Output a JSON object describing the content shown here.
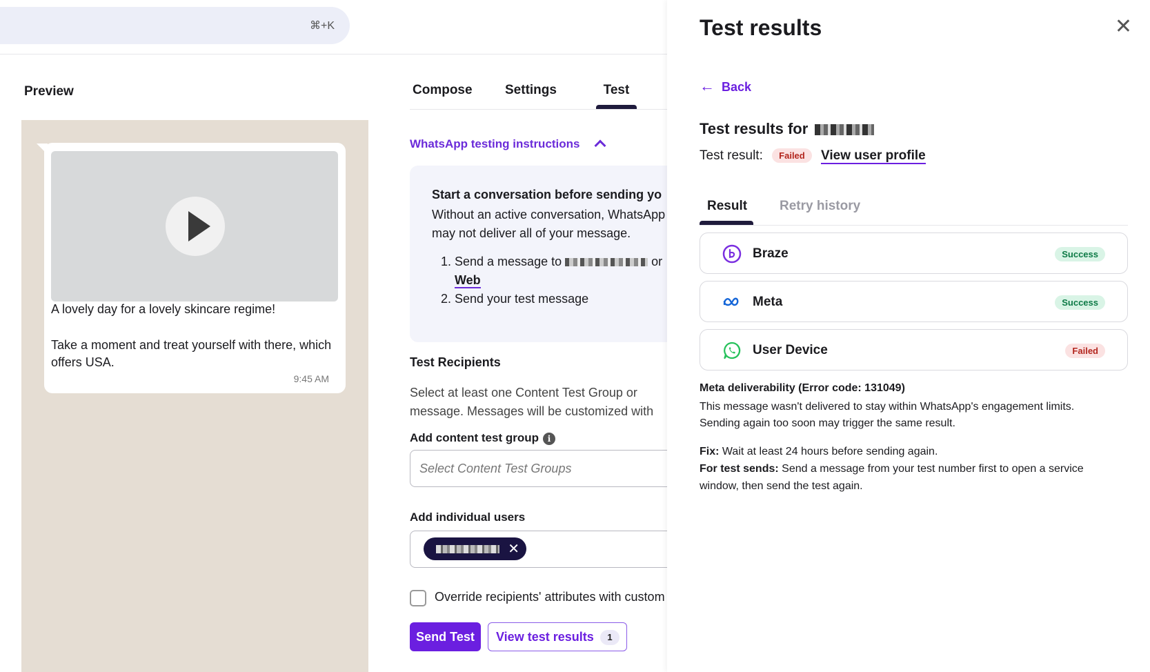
{
  "search": {
    "shortcut": "⌘+K"
  },
  "preview": {
    "title": "Preview",
    "message_line1": "A lovely day for a lovely skincare regime!",
    "message_line2": "Take a moment and treat yourself with there, which offers USA.",
    "time": "9:45 AM"
  },
  "tabs": [
    {
      "label": "Compose"
    },
    {
      "label": "Settings"
    },
    {
      "label": "Test",
      "active": true
    }
  ],
  "instructions": {
    "toggle_label": "WhatsApp testing instructions",
    "title": "Start a conversation before sending yo",
    "body": "Without an active conversation, WhatsApp may not deliver all of your message.",
    "step1_prefix": "Send a message to",
    "step1_suffix": "or",
    "step1_link": "Web",
    "step2": "Send your test message"
  },
  "recipients": {
    "title": "Test Recipients",
    "body_line1": "Select at least one Content Test Group or",
    "body_line2": "message. Messages will be customized with",
    "content_group_label": "Add content test group",
    "content_group_placeholder": "Select Content Test Groups",
    "individual_label": "Add individual users",
    "override_label": "Override recipients' attributes with custom"
  },
  "actions": {
    "send_test": "Send Test",
    "view_results": "View test results",
    "results_count": "1"
  },
  "panel": {
    "title": "Test results",
    "back": "Back",
    "results_for": "Test results for",
    "result_label": "Test result:",
    "result_status": "Failed",
    "view_profile": "View user profile",
    "tabs": [
      {
        "label": "Result",
        "active": true
      },
      {
        "label": "Retry history"
      }
    ],
    "steps": [
      {
        "name": "Braze",
        "status": "Success",
        "icon": "braze-icon"
      },
      {
        "name": "Meta",
        "status": "Success",
        "icon": "meta-icon"
      },
      {
        "name": "User Device",
        "status": "Failed",
        "icon": "whatsapp-icon"
      }
    ],
    "error_title": "Meta deliverability (Error code: 131049)",
    "error_body": "This message wasn't delivered to stay within WhatsApp's engagement limits. Sending again too soon may trigger the same result.",
    "fix_label": "Fix:",
    "fix_text": "Wait at least 24 hours before sending again.",
    "test_sends_label": "For test sends:",
    "test_sends_text": "Send a message from your test number first to open a service window, then send the test again."
  },
  "colors": {
    "accent": "#6b1fe0",
    "success_bg": "#d9f4e6",
    "failed_bg": "#fbe2e2",
    "preview_bg": "#e5ddd3"
  }
}
